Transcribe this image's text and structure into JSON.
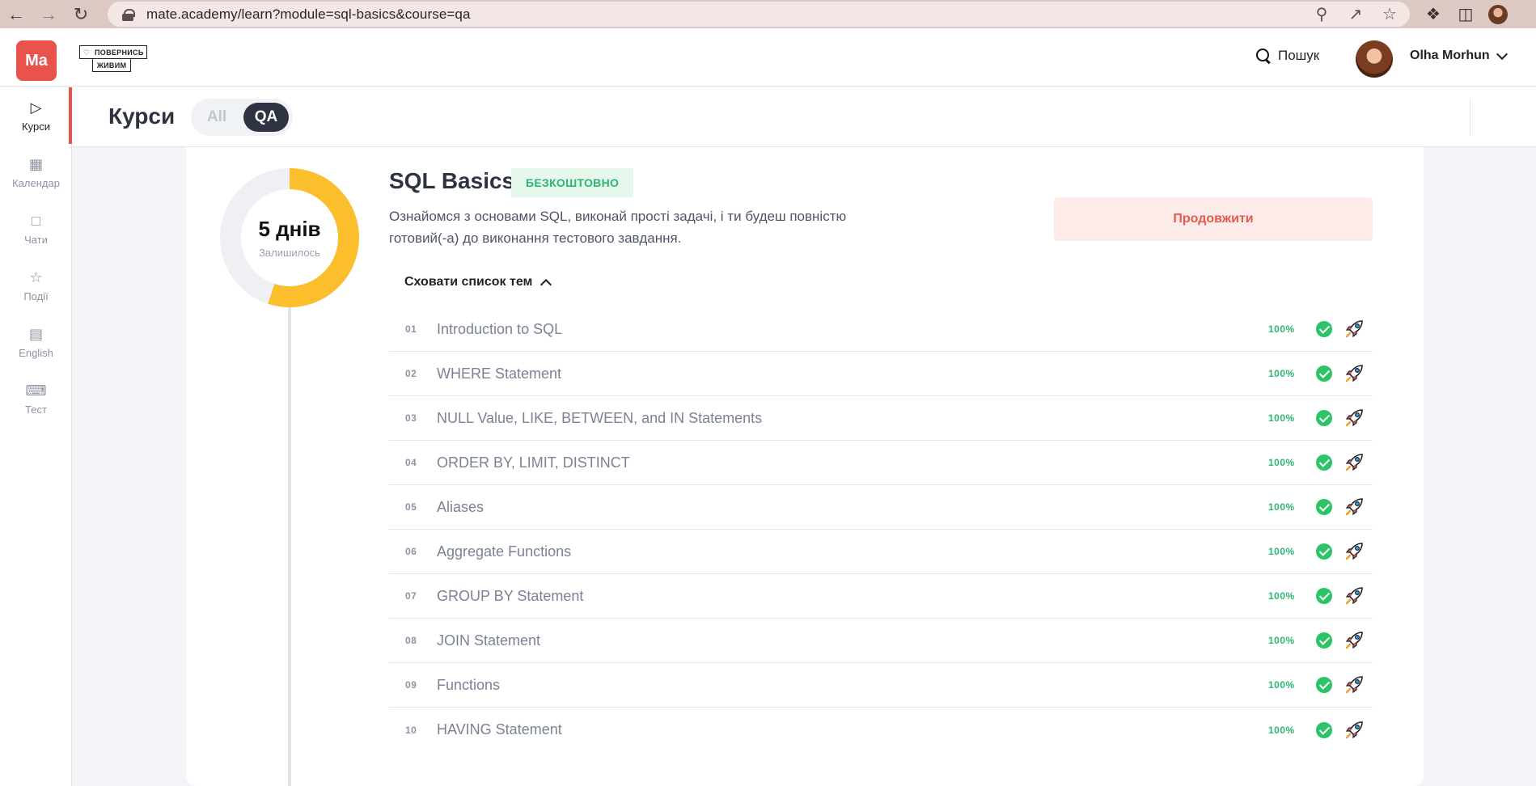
{
  "browser": {
    "url": "mate.academy/learn?module=sql-basics&course=qa"
  },
  "header": {
    "logo_text": "Ma",
    "badge_line1": "ПОВЕРНИСЬ",
    "badge_line2": "ЖИВИМ",
    "search_label": "Пошук",
    "user_name": "Olha Morhun"
  },
  "sidebar": {
    "items": [
      {
        "label": "Курси",
        "icon": "play-circle-icon",
        "active": true
      },
      {
        "label": "Календар",
        "icon": "calendar-icon",
        "active": false
      },
      {
        "label": "Чати",
        "icon": "chat-icon",
        "active": false
      },
      {
        "label": "Події",
        "icon": "star-icon",
        "active": false
      },
      {
        "label": "English",
        "icon": "translate-icon",
        "active": false
      },
      {
        "label": "Тест",
        "icon": "keyboard-icon",
        "active": false
      }
    ]
  },
  "topbar": {
    "title": "Курси",
    "toggle_all": "All",
    "toggle_qa": "QA",
    "selected": "QA"
  },
  "course": {
    "days_left": "5 днів",
    "days_left_label": "Залишилось",
    "progress_fraction": 0.55,
    "title": "SQL Basics",
    "badge": "БЕЗКОШТОВНО",
    "description": "Ознайомся з основами SQL, виконай прості задачі, і ти будеш повністю готовий(-а) до виконання тестового завдання.",
    "continue_label": "Продовжити",
    "hide_topics_label": "Сховати список тем",
    "topics": [
      {
        "num": "01",
        "title": "Introduction to SQL",
        "progress": "100%"
      },
      {
        "num": "02",
        "title": "WHERE Statement",
        "progress": "100%"
      },
      {
        "num": "03",
        "title": "NULL Value, LIKE, BETWEEN, and IN Statements",
        "progress": "100%"
      },
      {
        "num": "04",
        "title": "ORDER BY, LIMIT, DISTINCT",
        "progress": "100%"
      },
      {
        "num": "05",
        "title": "Aliases",
        "progress": "100%"
      },
      {
        "num": "06",
        "title": "Aggregate Functions",
        "progress": "100%"
      },
      {
        "num": "07",
        "title": "GROUP BY Statement",
        "progress": "100%"
      },
      {
        "num": "08",
        "title": "JOIN Statement",
        "progress": "100%"
      },
      {
        "num": "09",
        "title": "Functions",
        "progress": "100%"
      },
      {
        "num": "10",
        "title": "HAVING Statement",
        "progress": "100%"
      }
    ]
  },
  "colors": {
    "brand": "#e8534b",
    "donut": "#fbbf2e",
    "success": "#2bb673"
  }
}
